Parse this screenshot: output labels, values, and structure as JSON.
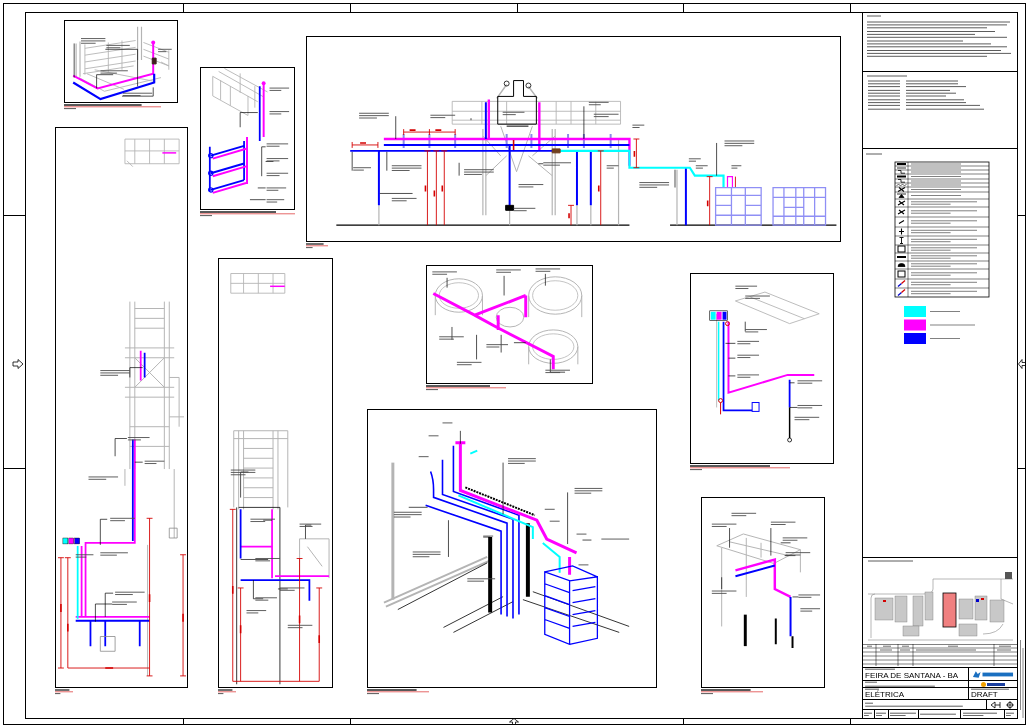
{
  "legend": {
    "color_keys": [
      {
        "color": "#00ffff"
      },
      {
        "color": "#ff00ff"
      },
      {
        "color": "#0000ff"
      }
    ]
  },
  "title_block": {
    "location": "FEIRA DE SANTANA - BA",
    "discipline": "ELÉTRICA",
    "status": "DRAFT"
  }
}
